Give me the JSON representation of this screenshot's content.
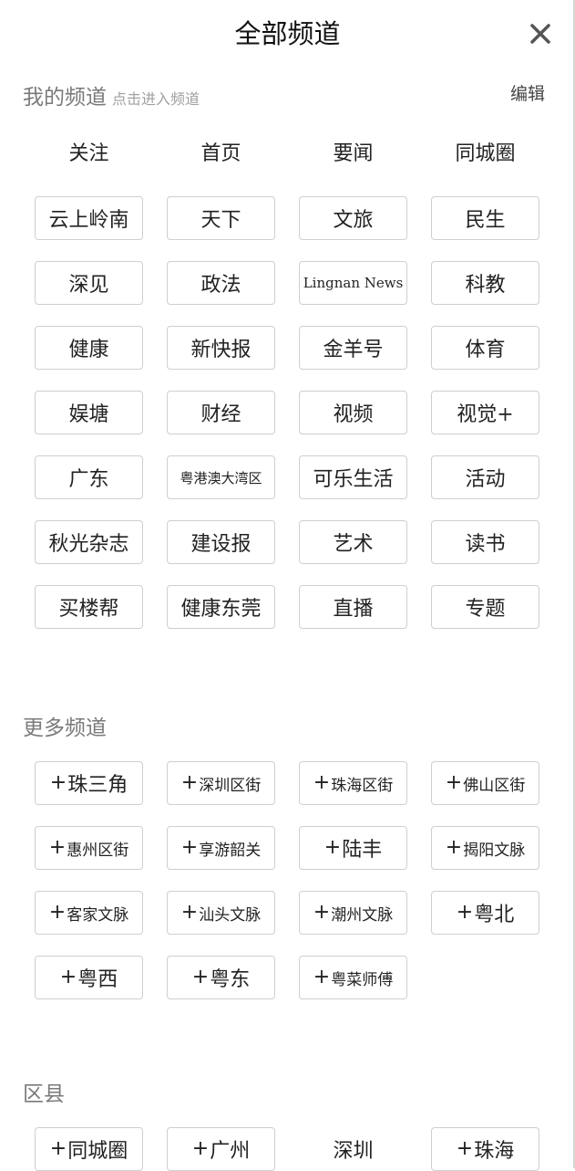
{
  "header": {
    "title": "全部频道",
    "close_icon": "close-icon"
  },
  "my_channels": {
    "heading": "我的频道",
    "hint": "点击进入频道",
    "edit_label": "编辑",
    "fixed": [
      "关注",
      "首页",
      "要闻",
      "同城圈"
    ],
    "items": [
      "云上岭南",
      "天下",
      "文旅",
      "民生",
      "深见",
      "政法",
      "Lingnan News",
      "科教",
      "健康",
      "新快报",
      "金羊号",
      "体育",
      "娱塘",
      "财经",
      "视频",
      "视觉+",
      "广东",
      "粤港澳大湾区",
      "可乐生活",
      "活动",
      "秋光杂志",
      "建设报",
      "艺术",
      "读书",
      "买楼帮",
      "健康东莞",
      "直播",
      "专题"
    ]
  },
  "more_channels": {
    "heading": "更多频道",
    "plus_glyph": "+",
    "items": [
      "珠三角",
      "深圳区街",
      "珠海区街",
      "佛山区街",
      "惠州区街",
      "享游韶关",
      "陆丰",
      "揭阳文脉",
      "客家文脉",
      "汕头文脉",
      "潮州文脉",
      "粤北",
      "粤西",
      "粤东",
      "粤菜师傅"
    ]
  },
  "districts": {
    "heading": "区县",
    "plus_glyph": "+",
    "items": [
      {
        "label": "同城圈",
        "plus": true
      },
      {
        "label": "广州",
        "plus": true
      },
      {
        "label": "深圳",
        "plus": false
      },
      {
        "label": "珠海",
        "plus": true
      }
    ]
  },
  "colors": {
    "border": "#cfcfcf",
    "heading": "#7a7a7a",
    "text": "#222222"
  }
}
